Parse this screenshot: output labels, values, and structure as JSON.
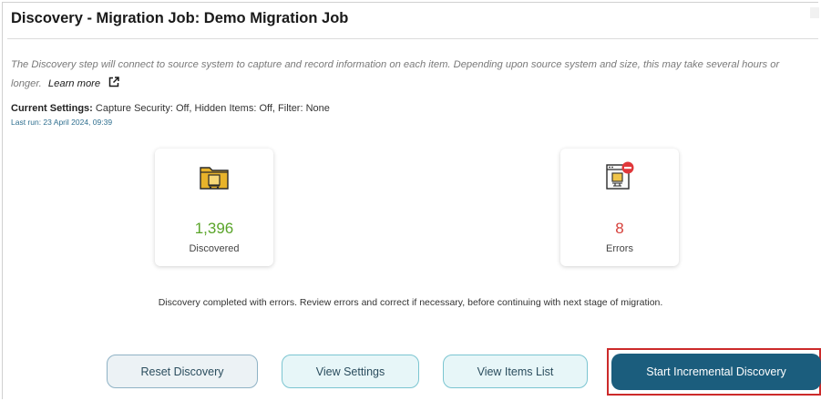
{
  "header": {
    "title": "Discovery - Migration Job: Demo Migration Job"
  },
  "description": {
    "text": "The Discovery step will connect to source system to capture and record information on each item. Depending upon source system and size, this may take several hours or longer.",
    "learn_more": "Learn more"
  },
  "settings": {
    "label": "Current Settings:",
    "value": "Capture Security: Off, Hidden Items: Off, Filter: None",
    "last_run": "Last run: 23 April 2024, 09:39"
  },
  "stats": {
    "discovered": {
      "count": "1,396",
      "label": "Discovered",
      "icon": "folder-icon",
      "color": "#5aa52a"
    },
    "errors": {
      "count": "8",
      "label": "Errors",
      "icon": "document-error-icon",
      "color": "#d6403b"
    }
  },
  "status_message": "Discovery completed with errors. Review errors and correct if necessary, before continuing with next stage of migration.",
  "actions": {
    "reset": "Reset Discovery",
    "view_settings": "View Settings",
    "view_items": "View Items List",
    "start_incremental": "Start Incremental Discovery"
  },
  "colors": {
    "primary": "#1b5d7d",
    "highlight_border": "#cc2a2a",
    "link": "#2f6f8f"
  }
}
